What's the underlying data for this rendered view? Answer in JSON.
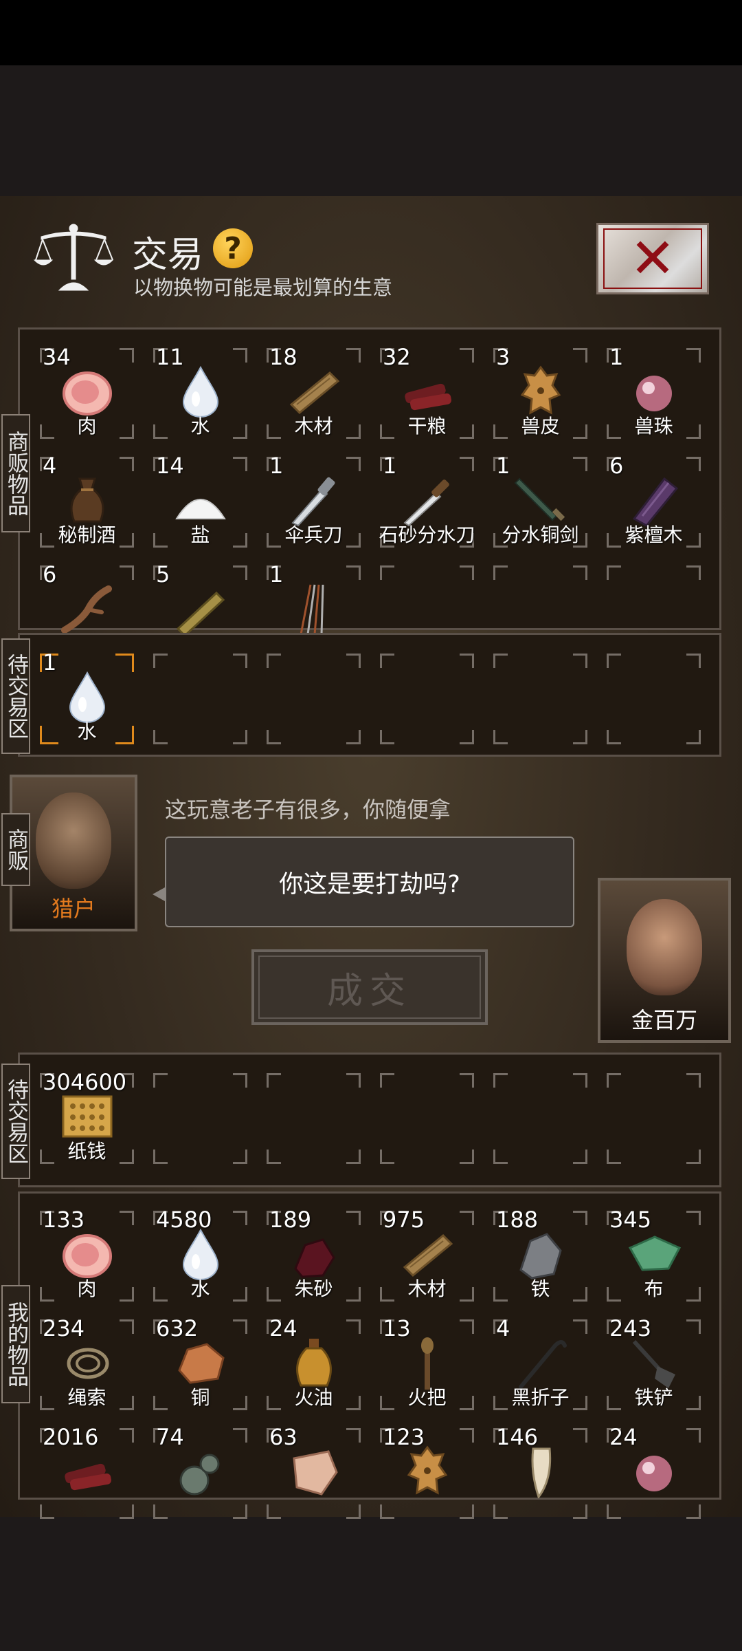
{
  "header": {
    "title": "交易",
    "help": "?",
    "subtitle": "以物换物可能是最划算的生意"
  },
  "labels": {
    "merchant_items": "商贩物品",
    "pending_top": "待交易区",
    "merchant": "商贩",
    "pending_bottom": "待交易区",
    "my_items": "我的物品"
  },
  "merchant_inventory": [
    {
      "qty": "34",
      "name": "肉",
      "icon": "meat-icon"
    },
    {
      "qty": "11",
      "name": "水",
      "icon": "water-drop-icon"
    },
    {
      "qty": "18",
      "name": "木材",
      "icon": "wood-plank-icon"
    },
    {
      "qty": "32",
      "name": "干粮",
      "icon": "dried-food-icon"
    },
    {
      "qty": "3",
      "name": "兽皮",
      "icon": "animal-hide-icon"
    },
    {
      "qty": "1",
      "name": "兽珠",
      "icon": "pearl-icon"
    },
    {
      "qty": "4",
      "name": "秘制酒",
      "icon": "wine-jar-icon"
    },
    {
      "qty": "14",
      "name": "盐",
      "icon": "salt-pile-icon"
    },
    {
      "qty": "1",
      "name": "伞兵刀",
      "icon": "paratrooper-knife-icon"
    },
    {
      "qty": "1",
      "name": "石砂分水刀",
      "icon": "knife-icon"
    },
    {
      "qty": "1",
      "name": "分水铜剑",
      "icon": "bronze-sword-icon"
    },
    {
      "qty": "6",
      "name": "紫檀木",
      "icon": "rosewood-icon"
    },
    {
      "qty": "6",
      "name": "",
      "icon": "root-icon"
    },
    {
      "qty": "5",
      "name": "",
      "icon": "bamboo-plank-icon"
    },
    {
      "qty": "1",
      "name": "",
      "icon": "needles-icon"
    }
  ],
  "pending_merchant": [
    {
      "qty": "1",
      "name": "水",
      "icon": "water-drop-icon"
    }
  ],
  "merchant_npc": {
    "name": "猎户",
    "line": "这玩意老子有很多，你随便拿"
  },
  "player_reply": "你这是要打劫吗?",
  "deal_button": "成交",
  "player_npc": {
    "name": "金百万"
  },
  "pending_player": [
    {
      "qty": "304600",
      "name": "纸钱",
      "icon": "paper-money-icon"
    }
  ],
  "my_inventory": [
    {
      "qty": "133",
      "name": "肉",
      "icon": "meat-icon"
    },
    {
      "qty": "4580",
      "name": "水",
      "icon": "water-drop-icon"
    },
    {
      "qty": "189",
      "name": "朱砂",
      "icon": "cinnabar-icon"
    },
    {
      "qty": "975",
      "name": "木材",
      "icon": "wood-plank-icon"
    },
    {
      "qty": "188",
      "name": "铁",
      "icon": "iron-ore-icon"
    },
    {
      "qty": "345",
      "name": "布",
      "icon": "cloth-icon"
    },
    {
      "qty": "234",
      "name": "绳索",
      "icon": "rope-icon"
    },
    {
      "qty": "632",
      "name": "铜",
      "icon": "copper-ore-icon"
    },
    {
      "qty": "24",
      "name": "火油",
      "icon": "oil-bottle-icon"
    },
    {
      "qty": "13",
      "name": "火把",
      "icon": "torch-icon"
    },
    {
      "qty": "4",
      "name": "黑折子",
      "icon": "crowbar-icon"
    },
    {
      "qty": "243",
      "name": "铁铲",
      "icon": "shovel-icon"
    },
    {
      "qty": "2016",
      "name": "",
      "icon": "dried-food-icon"
    },
    {
      "qty": "74",
      "name": "",
      "icon": "gourd-icon"
    },
    {
      "qty": "63",
      "name": "",
      "icon": "hide-scrap-icon"
    },
    {
      "qty": "123",
      "name": "",
      "icon": "animal-hide-icon"
    },
    {
      "qty": "146",
      "name": "",
      "icon": "fang-icon"
    },
    {
      "qty": "24",
      "name": "",
      "icon": "pearl-icon"
    }
  ]
}
